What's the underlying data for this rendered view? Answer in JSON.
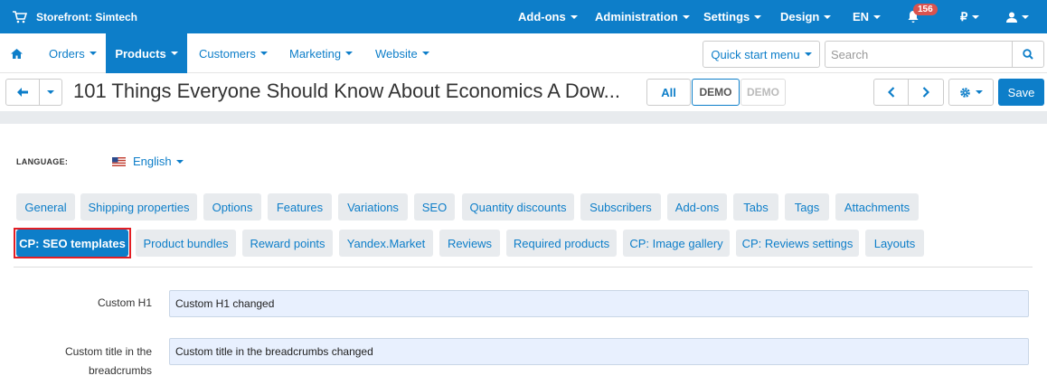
{
  "topbar": {
    "store_label": "Storefront: Simtech",
    "menus": [
      "Add-ons",
      "Administration",
      "Settings",
      "Design",
      "EN",
      "₽"
    ],
    "notifications_count": "156"
  },
  "mainnav": {
    "items": [
      "Orders",
      "Products",
      "Customers",
      "Marketing",
      "Website"
    ],
    "quick_start": "Quick start menu",
    "search_placeholder": "Search"
  },
  "toolbar": {
    "title": "101 Things Everyone Should Know About Economics A Dow...",
    "all_label": "All",
    "demo1": "DEMO",
    "demo2": "DEMO",
    "save_label": "Save"
  },
  "language": {
    "label": "LANGUAGE:",
    "value": "English"
  },
  "tabs_row1": [
    "General",
    "Shipping properties",
    "Options",
    "Features",
    "Variations",
    "SEO",
    "Quantity discounts",
    "Subscribers",
    "Add-ons",
    "Tabs",
    "Tags",
    "Attachments"
  ],
  "tabs_row2": [
    "CP: SEO templates",
    "Product bundles",
    "Reward points",
    "Yandex.Market",
    "Reviews",
    "Required products",
    "CP: Image gallery",
    "CP: Reviews settings",
    "Layouts"
  ],
  "fields": {
    "h1_label": "Custom H1",
    "h1_value": "Custom H1 changed",
    "breadcrumbs_label_1": "Custom title in the",
    "breadcrumbs_label_2": "breadcrumbs",
    "breadcrumbs_value": "Custom title in the breadcrumbs changed"
  },
  "colors": {
    "primary": "#0d7ec9",
    "tab_bg": "#e8ebee",
    "highlight": "#e31e24",
    "badge": "#d9534f"
  }
}
